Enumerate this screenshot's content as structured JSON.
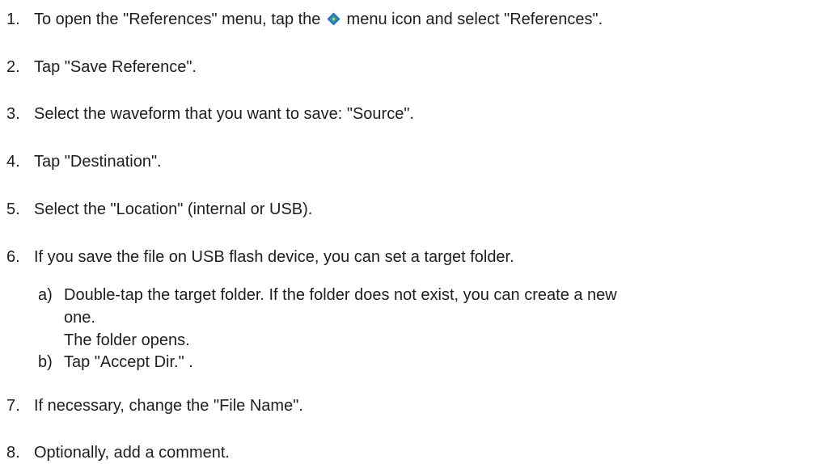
{
  "steps": [
    {
      "number": "1.",
      "before_icon": "To open the \"References\" menu, tap the ",
      "icon": "diamond-menu-icon",
      "after_icon": " menu icon and select \"References\"."
    },
    {
      "number": "2.",
      "text": "Tap \"Save Reference\"."
    },
    {
      "number": "3.",
      "text": "Select the waveform that you want to save: \"Source\"."
    },
    {
      "number": "4.",
      "text": "Tap \"Destination\"."
    },
    {
      "number": "5.",
      "text": "Select the \"Location\" (internal or USB)."
    },
    {
      "number": "6.",
      "text": "If you save the file on USB flash device, you can set a target folder."
    },
    {
      "number": "7.",
      "text": "If necessary, change the \"File Name\"."
    },
    {
      "number": "8.",
      "text": "Optionally, add a comment."
    }
  ],
  "substeps": [
    {
      "mark": "a)",
      "line1": "Double-tap the target folder. If the folder does not exist, you can create a new",
      "line2": "one.",
      "result": "The folder opens."
    },
    {
      "mark": "b)",
      "text": "Tap \"Accept Dir.\" ."
    }
  ],
  "colors": {
    "text": "#1e1e1e",
    "icon_blue": "#1f6fc8",
    "icon_green": "#3ea83a"
  }
}
